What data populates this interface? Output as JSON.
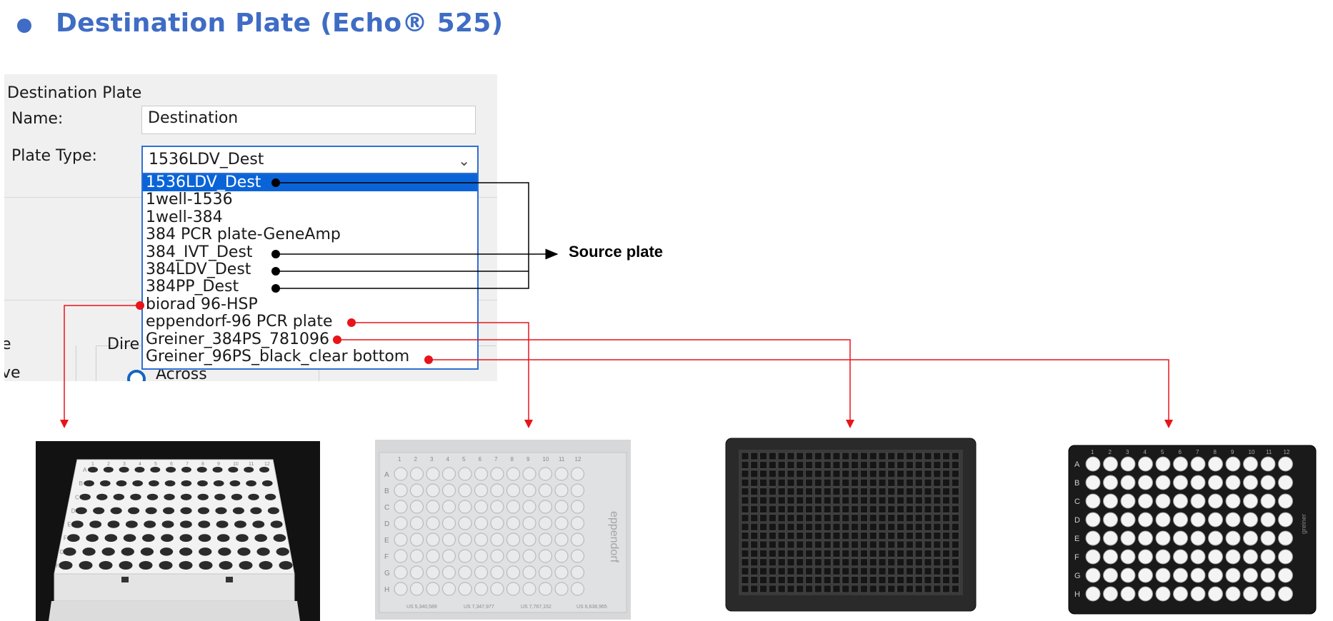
{
  "slide": {
    "title": "Destination Plate (Echo® 525)"
  },
  "dialog": {
    "group_title": "Destination Plate",
    "name_label": "Name:",
    "name_value": "Destination",
    "plate_type_label": "Plate Type:",
    "plate_type_value": "1536LDV_Dest",
    "options": [
      "1536LDV_Dest",
      "1well-1536",
      "1well-384",
      "384 PCR plate-GeneAmp",
      "384_IVT_Dest",
      "384LDV_Dest",
      "384PP_Dest",
      "biorad 96-HSP",
      "eppendorf-96 PCR plate",
      "Greiner_384PS_781096",
      "Greiner_96PS_black_clear bottom"
    ],
    "partial_labels": {
      "left_a": "e",
      "left_b": "ve",
      "dire": "Dire",
      "across": "Across"
    }
  },
  "annotations": {
    "source_plate_label": "Source plate"
  },
  "plates": {
    "biorad": {
      "rows": [
        "A",
        "B",
        "C",
        "D",
        "E",
        "F",
        "G",
        "H"
      ],
      "cols": [
        "1",
        "2",
        "3",
        "4",
        "5",
        "6",
        "7",
        "8",
        "9",
        "10",
        "11",
        "12"
      ]
    },
    "eppendorf": {
      "rows": [
        "A",
        "B",
        "C",
        "D",
        "E",
        "F",
        "G",
        "H"
      ],
      "cols": [
        "1",
        "2",
        "3",
        "4",
        "5",
        "6",
        "7",
        "8",
        "9",
        "10",
        "11",
        "12"
      ],
      "brand": "eppendorf",
      "patents": [
        "US 5,340,589",
        "US 7,347,977",
        "US 7,767,152",
        "US 6,638,965"
      ]
    },
    "greiner96": {
      "rows": [
        "A",
        "B",
        "C",
        "D",
        "E",
        "F",
        "G",
        "H"
      ],
      "cols": [
        "1",
        "2",
        "3",
        "4",
        "5",
        "6",
        "7",
        "8",
        "9",
        "10",
        "11",
        "12"
      ],
      "brand": "greiner"
    }
  },
  "colors": {
    "title": "#3F6CC4",
    "selection": "#0A64D8",
    "red_connector": "#E8141A",
    "black_connector": "#000000"
  }
}
